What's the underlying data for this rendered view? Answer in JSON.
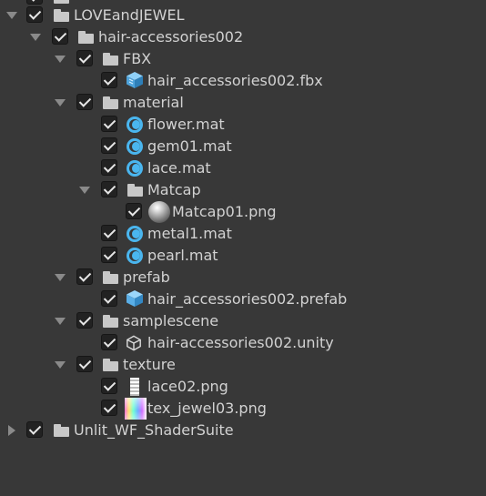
{
  "tree": {
    "items": [
      {
        "label": "",
        "icon": "folder-icon"
      },
      {
        "label": "LOVEandJEWEL",
        "icon": "folder-icon",
        "expanded": true,
        "checked": true
      },
      {
        "label": "hair-accessories002",
        "icon": "folder-icon",
        "expanded": true,
        "checked": true
      },
      {
        "label": "FBX",
        "icon": "folder-icon",
        "expanded": true,
        "checked": true
      },
      {
        "label": "hair_accessories002.fbx",
        "icon": "model-prefab-icon",
        "checked": true
      },
      {
        "label": "material",
        "icon": "folder-icon",
        "expanded": true,
        "checked": true
      },
      {
        "label": "flower.mat",
        "icon": "material-icon",
        "checked": true
      },
      {
        "label": "gem01.mat",
        "icon": "material-icon",
        "checked": true
      },
      {
        "label": "lace.mat",
        "icon": "material-icon",
        "checked": true
      },
      {
        "label": "Matcap",
        "icon": "folder-icon",
        "expanded": true,
        "checked": true
      },
      {
        "label": "Matcap01.png",
        "icon": "matcap-texture-icon",
        "checked": true
      },
      {
        "label": "metal1.mat",
        "icon": "material-icon",
        "checked": true
      },
      {
        "label": "pearl.mat",
        "icon": "material-icon",
        "checked": true
      },
      {
        "label": "prefab",
        "icon": "folder-icon",
        "expanded": true,
        "checked": true
      },
      {
        "label": "hair_accessories002.prefab",
        "icon": "prefab-icon",
        "checked": true
      },
      {
        "label": "samplescene",
        "icon": "folder-icon",
        "expanded": true,
        "checked": true
      },
      {
        "label": "hair-accessories002.unity",
        "icon": "unity-scene-icon",
        "checked": true
      },
      {
        "label": "texture",
        "icon": "folder-icon",
        "expanded": true,
        "checked": true
      },
      {
        "label": "lace02.png",
        "icon": "lace-texture-icon",
        "checked": true
      },
      {
        "label": "tex_jewel03.png",
        "icon": "jewel-texture-icon",
        "checked": true
      },
      {
        "label": "Unlit_WF_ShaderSuite",
        "icon": "folder-icon",
        "expanded": false,
        "checked": true
      }
    ]
  },
  "colors": {
    "background": "#383838",
    "text": "#d2d2d2",
    "checkbox": "#222222",
    "material_blue": "#4ab6ef",
    "prefab_blue": "#5aaee6"
  }
}
